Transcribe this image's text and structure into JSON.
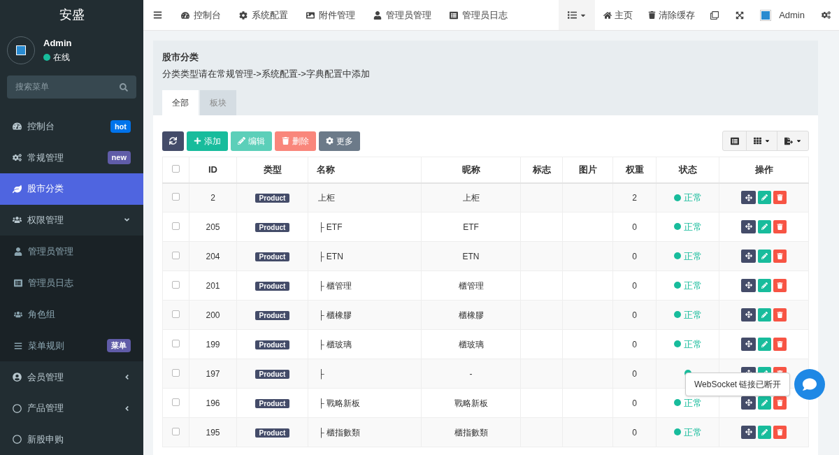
{
  "sidebar": {
    "brand": "安盛",
    "user": {
      "name": "Admin",
      "status": "在线"
    },
    "search": {
      "placeholder": "搜索菜单"
    },
    "items": [
      {
        "label": "控制台",
        "selected": false,
        "badge": {
          "text": "hot",
          "color": "#0073eb"
        }
      },
      {
        "label": "常规管理",
        "selected": false,
        "badge": {
          "text": "new",
          "color": "#605ca8"
        }
      },
      {
        "label": "股市分类",
        "selected": true
      },
      {
        "label": "权限管理",
        "selected": false,
        "expanded": true,
        "children": [
          {
            "label": "管理员管理",
            "selected": false
          },
          {
            "label": "管理员日志",
            "selected": false
          },
          {
            "label": "角色组",
            "selected": false
          },
          {
            "label": "菜单规则",
            "selected": false,
            "badge": {
              "text": "菜单",
              "color": "#605ca8"
            }
          }
        ]
      },
      {
        "label": "会员管理",
        "selected": false,
        "expanded": false
      },
      {
        "label": "产品管理",
        "selected": false,
        "expanded": false
      },
      {
        "label": "新股申购",
        "selected": false
      }
    ]
  },
  "topnav": {
    "tabs": [
      "控制台",
      "系统配置",
      "附件管理",
      "管理员管理",
      "管理员日志"
    ],
    "right": [
      "主页",
      "清除缓存"
    ],
    "user": "Admin"
  },
  "panel": {
    "title": "股市分类",
    "subtitle": "分类类型请在常规管理->系统配置->字典配置中添加",
    "tabs": [
      {
        "label": "全部",
        "selected": true
      },
      {
        "label": "板块",
        "selected": false
      }
    ],
    "toolbar": [
      {
        "kind": "refresh"
      },
      {
        "kind": "add",
        "label": "添加"
      },
      {
        "kind": "edit",
        "label": "编辑",
        "disabled": true
      },
      {
        "kind": "delete",
        "label": "删除",
        "disabled": true
      },
      {
        "kind": "more",
        "label": "更多"
      }
    ]
  },
  "table": {
    "all_checked": false,
    "columns": [
      "ID",
      "类型",
      "名称",
      "昵称",
      "标志",
      "图片",
      "权重",
      "状态",
      "操作"
    ],
    "rows": [
      {
        "checked": false,
        "id": "2",
        "type": "Product",
        "name": "上柜",
        "nickname": "上柜",
        "weight": "2",
        "status": "正常"
      },
      {
        "checked": false,
        "id": "205",
        "type": "Product",
        "name": "├ ETF",
        "nickname": "ETF",
        "weight": "0",
        "status": "正常"
      },
      {
        "checked": false,
        "id": "204",
        "type": "Product",
        "name": "├ ETN",
        "nickname": "ETN",
        "weight": "0",
        "status": "正常"
      },
      {
        "checked": false,
        "id": "201",
        "type": "Product",
        "name": "├ 櫃管理",
        "nickname": "櫃管理",
        "weight": "0",
        "status": "正常"
      },
      {
        "checked": false,
        "id": "200",
        "type": "Product",
        "name": "├ 櫃橡膠",
        "nickname": "櫃橡膠",
        "weight": "0",
        "status": "正常"
      },
      {
        "checked": false,
        "id": "199",
        "type": "Product",
        "name": "├ 櫃玻璃",
        "nickname": "櫃玻璃",
        "weight": "0",
        "status": "正常"
      },
      {
        "checked": false,
        "id": "197",
        "type": "Product",
        "name": "├",
        "nickname": "-",
        "weight": "0"
      },
      {
        "checked": false,
        "id": "196",
        "type": "Product",
        "name": "├ 戰略新板",
        "nickname": "戰略新板",
        "weight": "0",
        "status": "正常"
      },
      {
        "checked": false,
        "id": "195",
        "type": "Product",
        "name": "├ 櫃指數類",
        "nickname": "櫃指數類",
        "weight": "0",
        "status": "正常"
      }
    ]
  },
  "toast": {
    "text": "WebSocket 链接已断开"
  }
}
